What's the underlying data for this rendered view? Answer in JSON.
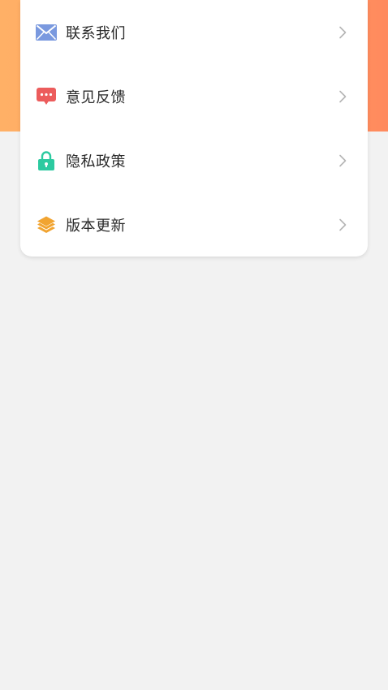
{
  "menu": {
    "items": [
      {
        "label": "联系我们",
        "icon": "mail-icon"
      },
      {
        "label": "意见反馈",
        "icon": "feedback-icon"
      },
      {
        "label": "隐私政策",
        "icon": "lock-icon"
      },
      {
        "label": "版本更新",
        "icon": "layers-icon"
      }
    ]
  },
  "colors": {
    "header_gradient_start": "#ffb066",
    "header_gradient_end": "#ff8a5e",
    "mail_icon": "#7a99df",
    "feedback_icon": "#ec5c5c",
    "lock_icon": "#2ccaa0",
    "layers_icon": "#f1a431",
    "chevron": "#b5b5b5",
    "page_background": "#f2f2f2"
  }
}
